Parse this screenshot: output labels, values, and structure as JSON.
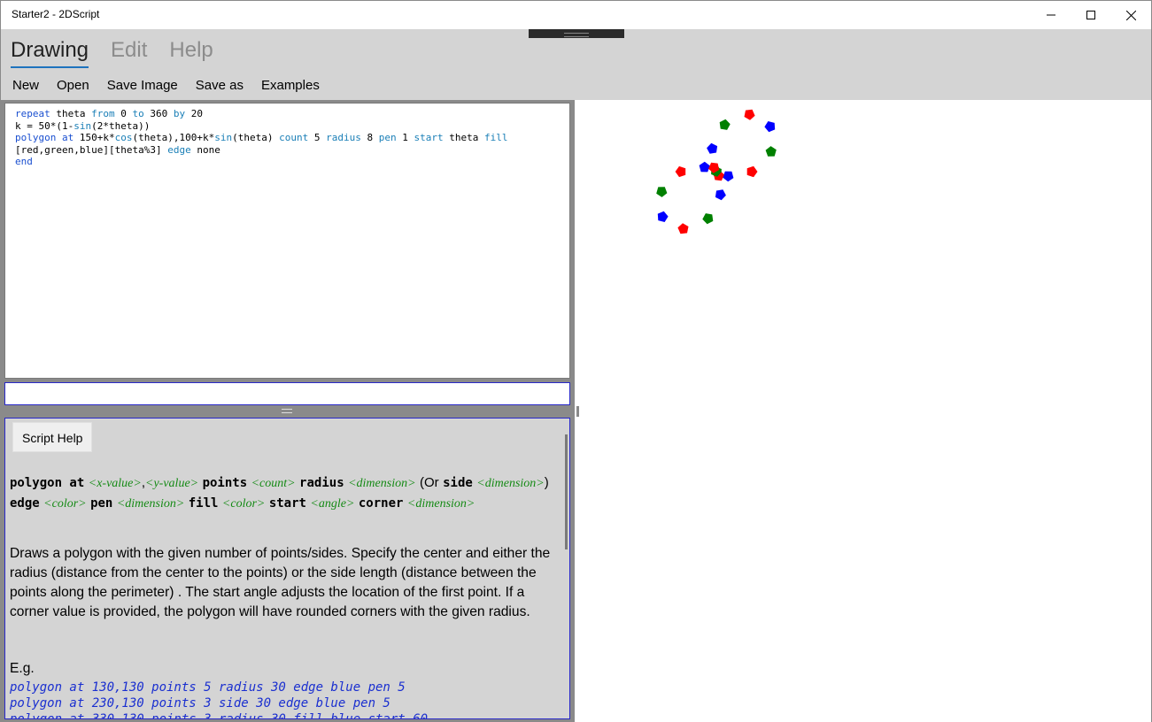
{
  "window": {
    "title": "Starter2 - 2DScript"
  },
  "tabs": [
    {
      "label": "Drawing",
      "active": true
    },
    {
      "label": "Edit",
      "active": false
    },
    {
      "label": "Help",
      "active": false
    }
  ],
  "menu": {
    "new": "New",
    "open": "Open",
    "save_image": "Save Image",
    "save_as": "Save as",
    "examples": "Examples"
  },
  "editor": {
    "lines": [
      "repeat theta from 0 to 360 by 20",
      "k = 50*(1-sin(2*theta))",
      "polygon at 150+k*cos(theta),100+k*sin(theta) count 5 radius 8 pen 1 start theta fill [red,green,blue][theta%3] edge none",
      "end"
    ]
  },
  "command_line": {
    "value": ""
  },
  "help": {
    "title": "Script Help",
    "syntax": {
      "kw_polygon_at": "polygon at",
      "x_value": "<x-value>",
      "comma": ",",
      "y_value": "<y-value>",
      "kw_points": "points",
      "count": "<count>",
      "kw_radius": "radius",
      "dimension1": "<dimension>",
      "or": "(Or",
      "kw_side": "side",
      "dimension2": "<dimension>",
      "close_paren": ")",
      "kw_edge": "edge",
      "color1": "<color>",
      "kw_pen": "pen",
      "dimension3": "<dimension>",
      "kw_fill": "fill",
      "color2": "<color>",
      "kw_start": "start",
      "angle": "<angle>",
      "kw_corner": "corner",
      "dimension4": "<dimension>"
    },
    "description": "Draws a polygon with the given number of points/sides. Specify the center and either the radius (distance from the center to the points)  or the side length (distance between the points along the perimeter) . The start angle adjusts the location of the first point. If a corner value is provided, the polygon will have rounded corners with the given radius.",
    "eg_label": "E.g.",
    "examples": [
      "polygon at 130,130 points 5 radius 30 edge blue pen 5",
      "polygon at 230,130 points 3 side 30 edge blue pen 5",
      "polygon at 330,130 points 3 radius 30 fill blue start 60"
    ]
  },
  "drawing": {
    "colors": [
      "#ff0000",
      "#008000",
      "#0000ff"
    ]
  }
}
